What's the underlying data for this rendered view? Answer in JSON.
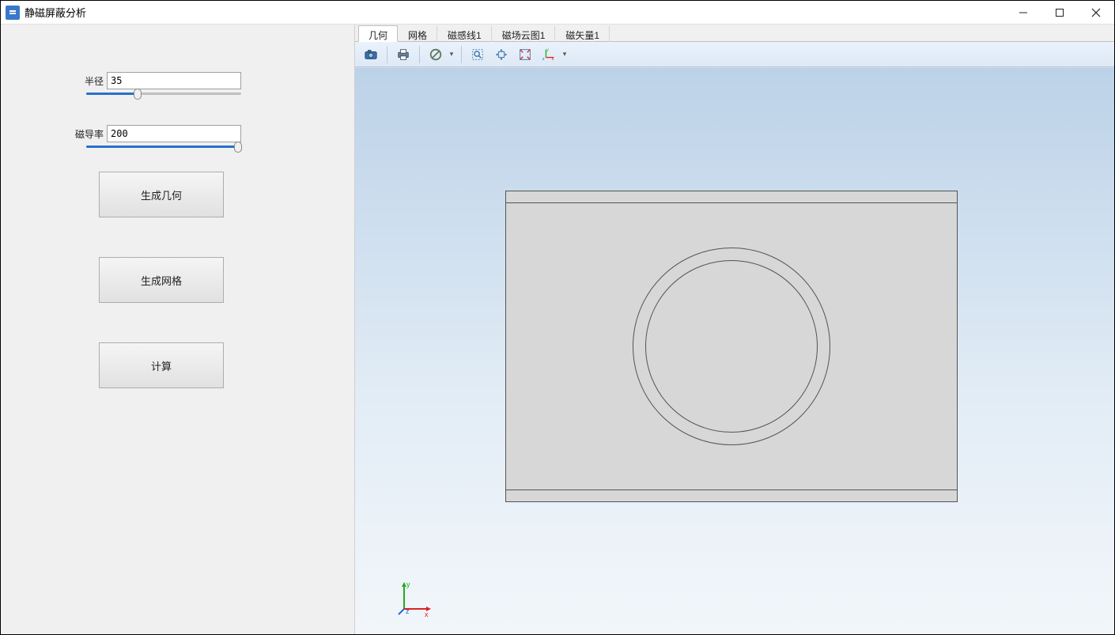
{
  "window": {
    "title": "静磁屏蔽分析"
  },
  "sidebar": {
    "radius_label": "半径",
    "radius_value": "35",
    "radius_slider_pct": 33,
    "perm_label": "磁导率",
    "perm_value": "200",
    "perm_slider_pct": 98,
    "btn_geometry": "生成几何",
    "btn_mesh": "生成网格",
    "btn_compute": "计算"
  },
  "tabs": [
    {
      "label": "几何",
      "active": true
    },
    {
      "label": "网格",
      "active": false
    },
    {
      "label": "磁感线1",
      "active": false
    },
    {
      "label": "磁场云图1",
      "active": false
    },
    {
      "label": "磁矢量1",
      "active": false
    }
  ],
  "toolbar_icons": {
    "camera": "camera-icon",
    "print": "print-icon",
    "nosymbol": "no-symbol-icon",
    "zoomrect": "zoom-rect-icon",
    "pan": "pan-icon",
    "zoomfit": "zoom-fit-icon",
    "axes": "axes-icon"
  },
  "axis_labels": {
    "x": "x",
    "y": "y",
    "z": "z"
  },
  "colors": {
    "accent": "#2a6fc9",
    "viewport_top": "#bcd2e8",
    "viewport_bottom": "#f2f6fa",
    "draw_fill": "#d7d7d7",
    "axis_x": "#d22",
    "axis_y": "#2a2",
    "axis_z": "#26d"
  }
}
